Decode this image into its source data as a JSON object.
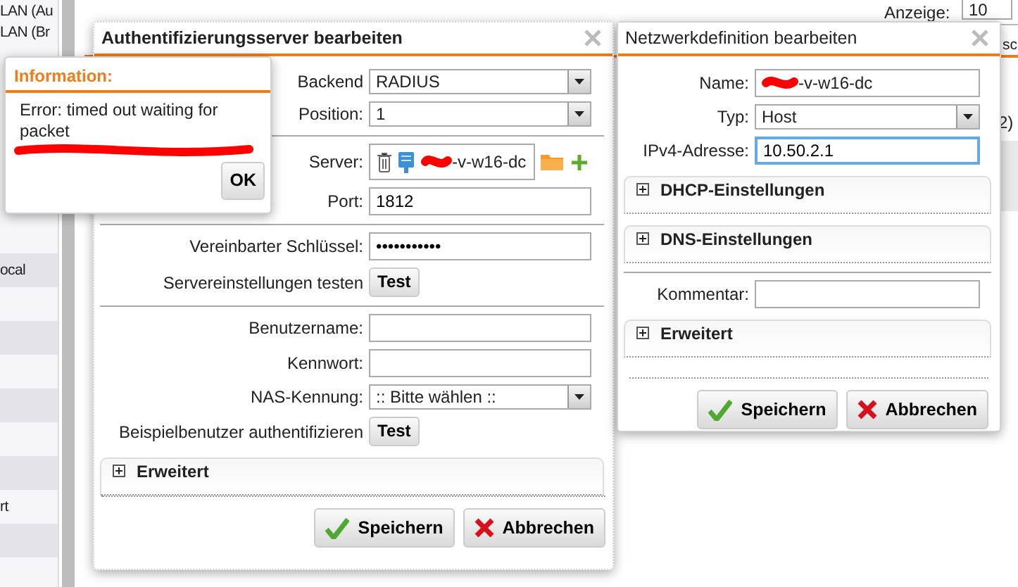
{
  "background": {
    "sidebar_items": [
      {
        "text": "LAN (Au"
      },
      {
        "text": "LAN (Br"
      },
      {
        "text": "ocal"
      },
      {
        "text": "rt"
      }
    ],
    "display_label": "Anzeige:",
    "display_value": "10",
    "tab_text": "sc",
    "note_text": "2)"
  },
  "auth_dialog": {
    "title": "Authentifizierungsserver bearbeiten",
    "active": true,
    "items": [
      {
        "kind": "select",
        "label": "Backend",
        "value": "RADIUS"
      },
      {
        "kind": "select",
        "label": "Position:",
        "value": "1"
      },
      {
        "kind": "divider"
      },
      {
        "kind": "server",
        "label": "Server:",
        "value": "-v-w16-dc",
        "redacted": true
      },
      {
        "kind": "text",
        "label": "Port:",
        "value": "1812",
        "focused": false
      },
      {
        "kind": "divider"
      },
      {
        "kind": "text",
        "label": "Vereinbarter Schlüssel:",
        "value": "•••••••••••",
        "focused": false
      },
      {
        "kind": "button",
        "label": "Servereinstellungen testen",
        "value": "Test"
      },
      {
        "kind": "divider"
      },
      {
        "kind": "text",
        "label": "Benutzername:",
        "focused": false
      },
      {
        "kind": "text",
        "label": "Kennwort:",
        "focused": false
      },
      {
        "kind": "select",
        "label": "NAS-Kennung:",
        "value": ":: Bitte wählen ::"
      },
      {
        "kind": "button",
        "label": "Beispielbenutzer authentifizieren",
        "value": "Test"
      },
      {
        "kind": "panel",
        "label": "Erweitert",
        "expanded": false
      }
    ],
    "buttons": [
      {
        "kind": "save",
        "label": "Speichern"
      },
      {
        "kind": "cancel",
        "label": "Abbrechen"
      }
    ]
  },
  "info_dialog": {
    "title": "Information:",
    "message": "Error: timed out waiting for packet",
    "redacted": true,
    "button": "OK"
  },
  "network_dialog": {
    "title": "Netzwerkdefinition bearbeiten",
    "active": false,
    "items": [
      {
        "kind": "text",
        "label": "Name:",
        "value": "-v-w16-dc",
        "redacted": true,
        "focused": false
      },
      {
        "kind": "select",
        "label": "Typ:",
        "value": "Host"
      },
      {
        "kind": "text",
        "label": "IPv4-Adresse:",
        "value": "10.50.2.1",
        "focused": true
      },
      {
        "kind": "panel",
        "label": "DHCP-Einstellungen",
        "expanded": false
      },
      {
        "kind": "panel",
        "label": "DNS-Einstellungen",
        "expanded": false
      },
      {
        "kind": "divider"
      },
      {
        "kind": "text",
        "label": "Kommentar:",
        "focused": false
      },
      {
        "kind": "panel",
        "label": "Erweitert",
        "expanded": false
      }
    ],
    "buttons": [
      {
        "kind": "save",
        "label": "Speichern"
      },
      {
        "kind": "cancel",
        "label": "Abbrechen"
      }
    ]
  }
}
